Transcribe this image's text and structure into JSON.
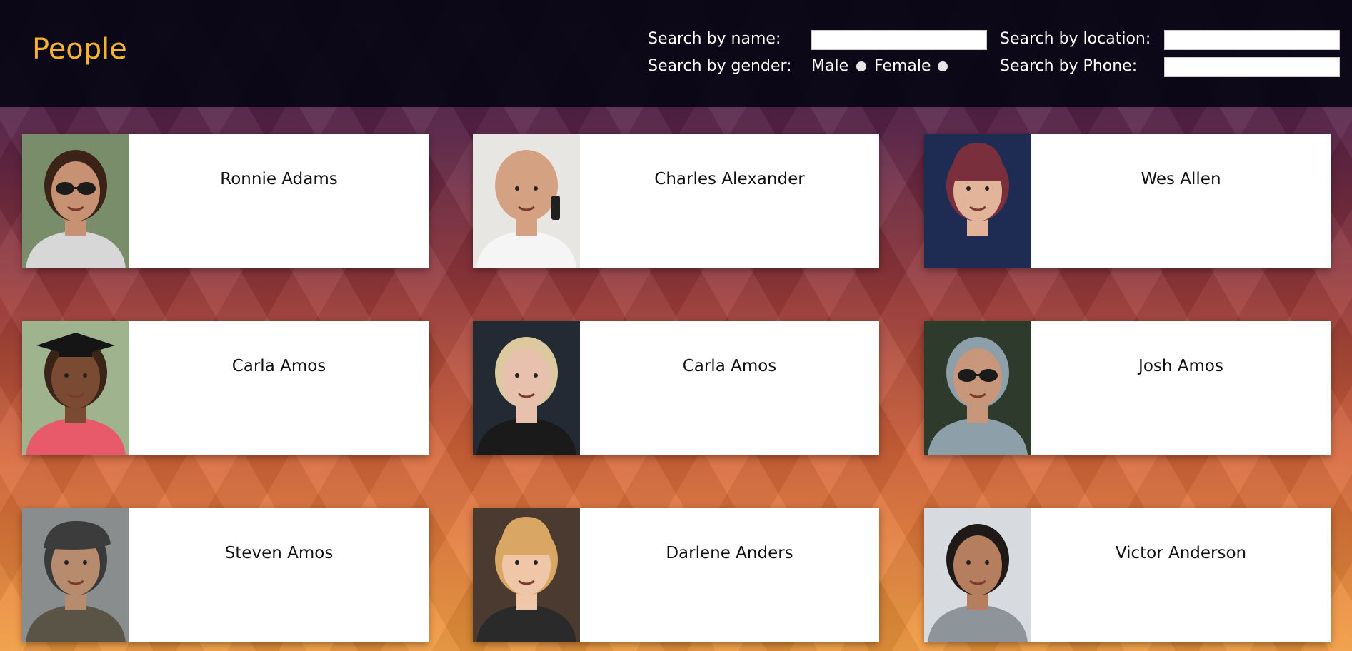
{
  "header": {
    "title": "People",
    "search_name_label": "Search by name:",
    "search_location_label": "Search by location:",
    "search_gender_label": "Search by gender:",
    "search_phone_label": "Search by Phone:",
    "gender_male_label": "Male",
    "gender_female_label": "Female",
    "search_name_value": "",
    "search_location_value": "",
    "search_phone_value": ""
  },
  "people": [
    {
      "name": "Ronnie Adams",
      "photo": {
        "bg": "#7a8d6a",
        "skin": "#c79274",
        "hair": "#3b2417",
        "shirt": "#d7d7d7",
        "accessory": "sunglasses-icon"
      }
    },
    {
      "name": "Charles Alexander",
      "photo": {
        "bg": "#e8e6e3",
        "skin": "#d4a182",
        "hair": "#d4a182",
        "shirt": "#f5f5f5",
        "accessory": "phone-icon"
      }
    },
    {
      "name": "Wes Allen",
      "photo": {
        "bg": "#1e2b52",
        "skin": "#e2b59b",
        "hair": "#7a2f3d",
        "shirt": "#1e2b52",
        "accessory": "beanie-icon"
      }
    },
    {
      "name": "Carla Amos",
      "photo": {
        "bg": "#9fb38f",
        "skin": "#7a4a32",
        "hair": "#3a2418",
        "shirt": "#e85a6a",
        "accessory": "grad-cap-icon"
      }
    },
    {
      "name": "Carla Amos",
      "photo": {
        "bg": "#242a33",
        "skin": "#e7c1ad",
        "hair": "#dcc9a0",
        "shirt": "#1a1a1a",
        "accessory": "none"
      }
    },
    {
      "name": "Josh Amos",
      "photo": {
        "bg": "#2e3a2c",
        "skin": "#c8967a",
        "hair": "#8da0aa",
        "shirt": "#8da0aa",
        "accessory": "sunglasses-icon"
      }
    },
    {
      "name": "Steven Amos",
      "photo": {
        "bg": "#8a8d8d",
        "skin": "#b78b6e",
        "hair": "#3a3a3a",
        "shirt": "#5a5446",
        "accessory": "flat-cap-icon"
      }
    },
    {
      "name": "Darlene Anders",
      "photo": {
        "bg": "#4a3a30",
        "skin": "#f0c6a8",
        "hair": "#d9a663",
        "shirt": "#2a2a2a",
        "accessory": "beanie-icon"
      }
    },
    {
      "name": "Victor Anderson",
      "photo": {
        "bg": "#d7dbe0",
        "skin": "#b57e5e",
        "hair": "#1f1a17",
        "shirt": "#8e959a",
        "accessory": "none"
      }
    }
  ]
}
